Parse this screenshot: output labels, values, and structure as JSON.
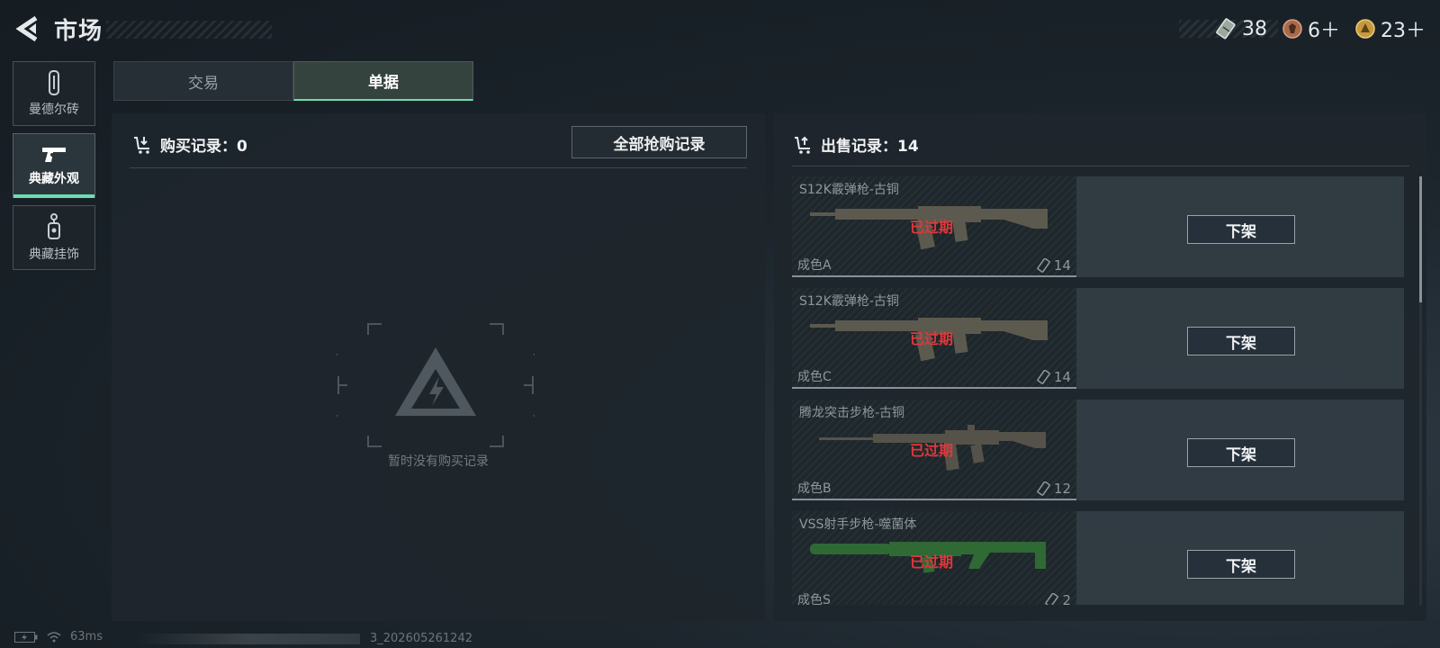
{
  "header": {
    "title": "市场",
    "currencies": [
      {
        "icon": "ticket-icon",
        "value": "38"
      },
      {
        "icon": "bronze-token-icon",
        "value": "6＋"
      },
      {
        "icon": "gold-token-icon",
        "value": "23＋"
      }
    ]
  },
  "nav": {
    "items": [
      {
        "label": "曼德尔砖",
        "icon": "mandel-brick-icon",
        "active": false
      },
      {
        "label": "典藏外观",
        "icon": "pistol-icon",
        "active": true
      },
      {
        "label": "典藏挂饰",
        "icon": "charm-icon",
        "active": false
      }
    ]
  },
  "tabs": [
    {
      "label": "交易",
      "active": false
    },
    {
      "label": "单据",
      "active": true
    }
  ],
  "purchase": {
    "heading": "购买记录：0",
    "all_button": "全部抢购记录",
    "empty_text": "暂时没有购买记录"
  },
  "sales": {
    "heading": "出售记录：14",
    "items": [
      {
        "name": "S12K霰弹枪-古铜",
        "grade": "成色A",
        "status": "已过期",
        "count": "14",
        "action": "下架",
        "gun_color": "#5c5a4e"
      },
      {
        "name": "S12K霰弹枪-古铜",
        "grade": "成色C",
        "status": "已过期",
        "count": "14",
        "action": "下架",
        "gun_color": "#5c5a4e"
      },
      {
        "name": "腾龙突击步枪-古铜",
        "grade": "成色B",
        "status": "已过期",
        "count": "12",
        "action": "下架",
        "gun_color": "#55524a"
      },
      {
        "name": "VSS射手步枪-噬菌体",
        "grade": "成色S",
        "status": "已过期",
        "count": "2",
        "action": "下架",
        "gun_color": "#2f6a35"
      }
    ]
  },
  "statusbar": {
    "ping": "63ms",
    "build": "3_202605261242"
  },
  "colors": {
    "accent": "#6ddcb0",
    "expired": "#e2373a"
  }
}
